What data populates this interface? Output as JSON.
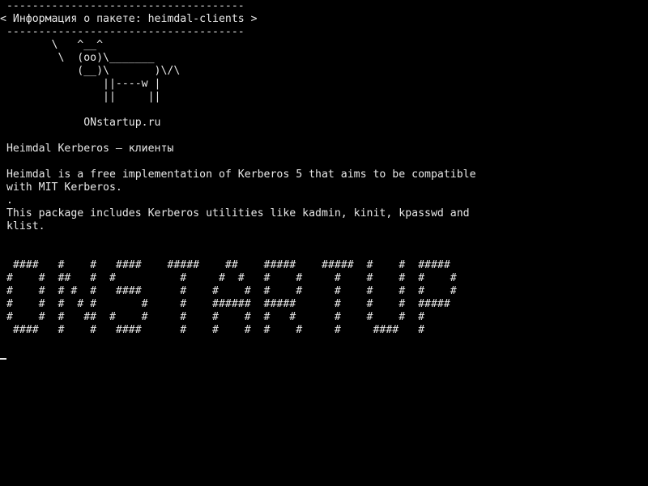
{
  "terminal": {
    "background": "#000000",
    "foreground": "#e8e8e8",
    "lines": [
      " -------------------------------------",
      "< Информация о пакете: heimdal-clients >",
      " -------------------------------------",
      "        \\   ^__^",
      "         \\  (oo)\\_______",
      "            (__)\\       )\\/\\",
      "                ||----w |",
      "                ||     ||",
      "",
      "             ONstartup.ru",
      "",
      " Heimdal Kerberos — клиенты",
      "",
      " Heimdal is a free implementation of Kerberos 5 that aims to be compatible",
      " with MIT Kerberos.",
      " .",
      " This package includes Kerberos utilities like kadmin, kinit, kpasswd and",
      " klist.",
      "",
      "",
      "  ####   #    #   ####    #####    ##    #####    #####  #    #  #####",
      " #    #  ##   #  #          #     #  #   #    #     #    #    #  #    #",
      " #    #  # #  #   ####      #    #    #  #    #     #    #    #  #    #",
      " #    #  #  # #       #     #    ######  #####      #    #    #  #####",
      " #    #  #   ##  #    #     #    #    #  #   #      #    #    #  #",
      "  ####   #    #   ####      #    #    #  #    #     #     ####   #"
    ]
  }
}
